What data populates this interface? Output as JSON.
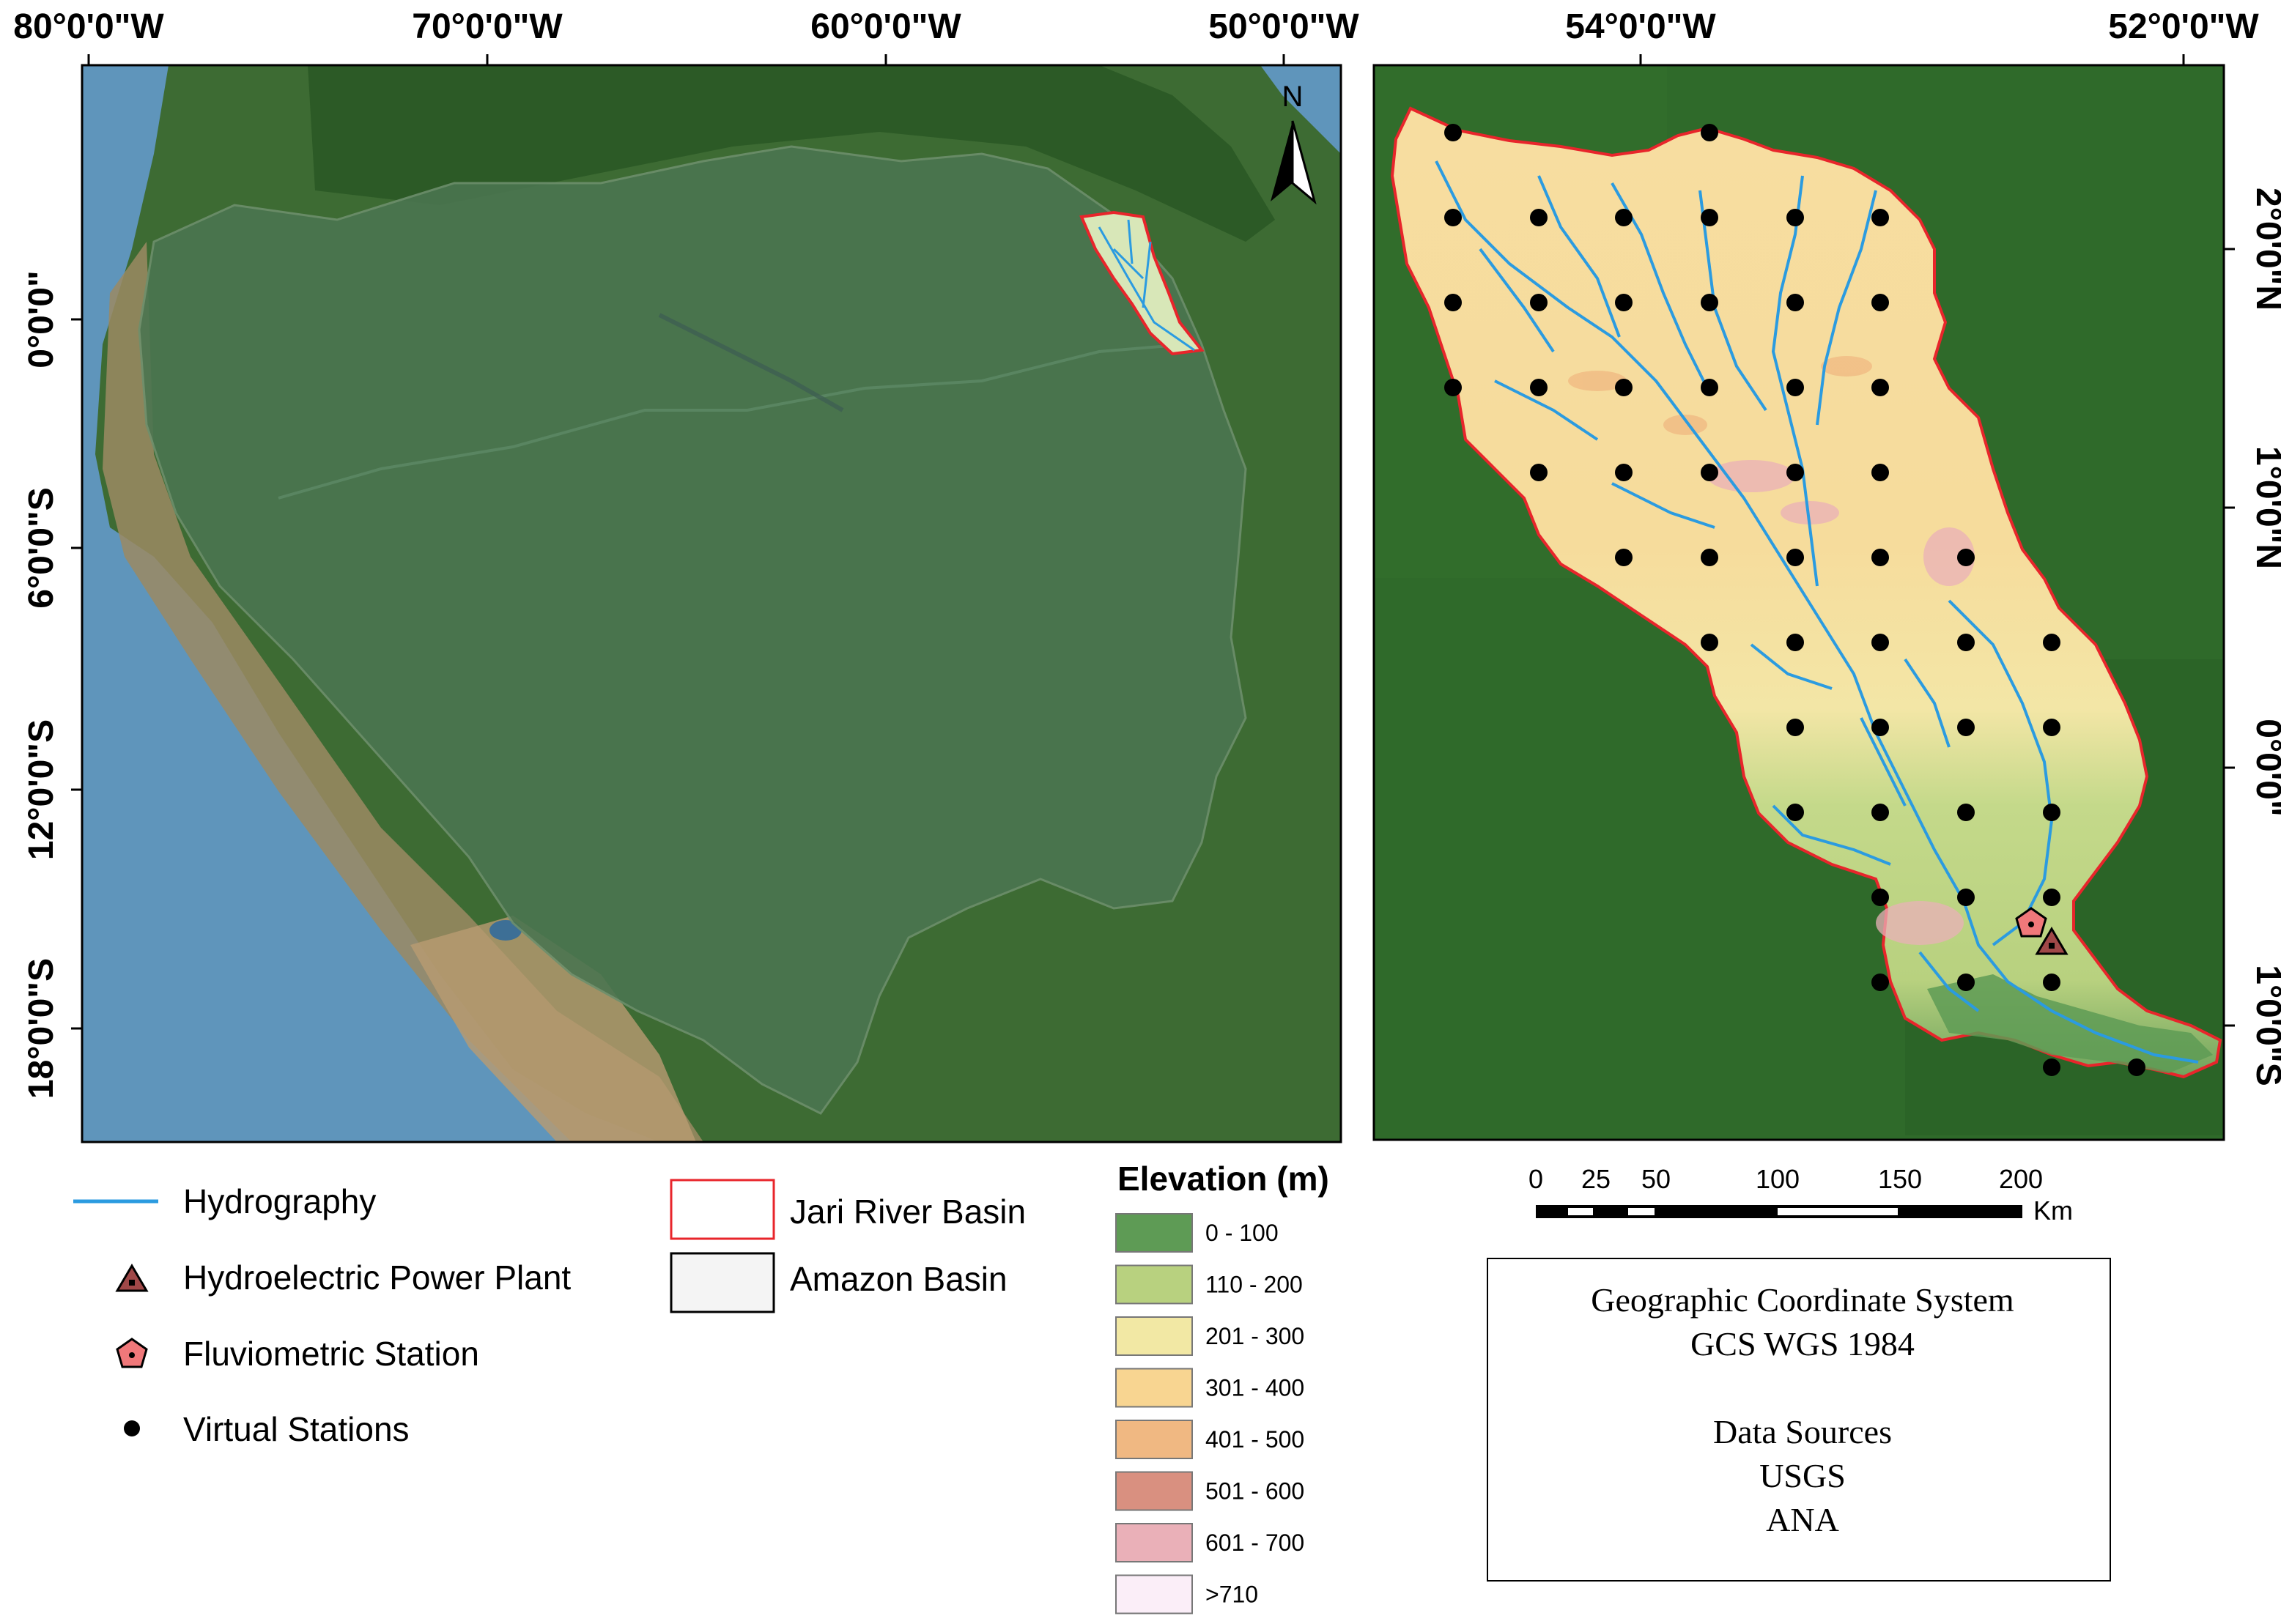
{
  "left_map": {
    "top_ticks": [
      "80°0'0\"W",
      "70°0'0\"W",
      "60°0'0\"W",
      "50°0'0\"W"
    ],
    "side_ticks": [
      "0°0'0\"",
      "6°0'0\"S",
      "12°0'0\"S",
      "18°0'0\"S"
    ],
    "north_label": "N"
  },
  "right_map": {
    "top_ticks": [
      "54°0'0\"W",
      "52°0'0\"W"
    ],
    "side_ticks": [
      "2°0'0\"N",
      "1°0'0\"N",
      "0°0'0\"",
      "1°0'0\"S"
    ]
  },
  "legend": {
    "hydrography": "Hydrography",
    "hydro_plant": "Hydroelectric Power Plant",
    "fluvio_station": "Fluviometric Station",
    "virtual_stations": "Virtual Stations",
    "jari_basin": "Jari River Basin",
    "amazon_basin": "Amazon Basin"
  },
  "elevation": {
    "title": "Elevation (m)",
    "classes": [
      {
        "label": "0 - 100",
        "color": "#5e9b55"
      },
      {
        "label": "110 - 200",
        "color": "#b8d17f"
      },
      {
        "label": "201 - 300",
        "color": "#f2e8a4"
      },
      {
        "label": "301 - 400",
        "color": "#f8d591"
      },
      {
        "label": "401 - 500",
        "color": "#f0b882"
      },
      {
        "label": "501 - 600",
        "color": "#d99080"
      },
      {
        "label": "601 - 700",
        "color": "#eab0b8"
      },
      {
        "label": ">710",
        "color": "#fbeef8"
      }
    ]
  },
  "scale_bar": {
    "ticks": [
      "0",
      "25",
      "50",
      "100",
      "150",
      "200"
    ],
    "unit": "Km"
  },
  "info_box": {
    "line1": "Geographic Coordinate System",
    "line2": "GCS WGS 1984",
    "line3": "Data Sources",
    "line4": "USGS",
    "line5": "ANA"
  },
  "colors": {
    "hydrography": "#2b9be0",
    "jari_outline": "#e8252b",
    "forest": "#2f6a2a",
    "ocean": "#5b93b8"
  }
}
